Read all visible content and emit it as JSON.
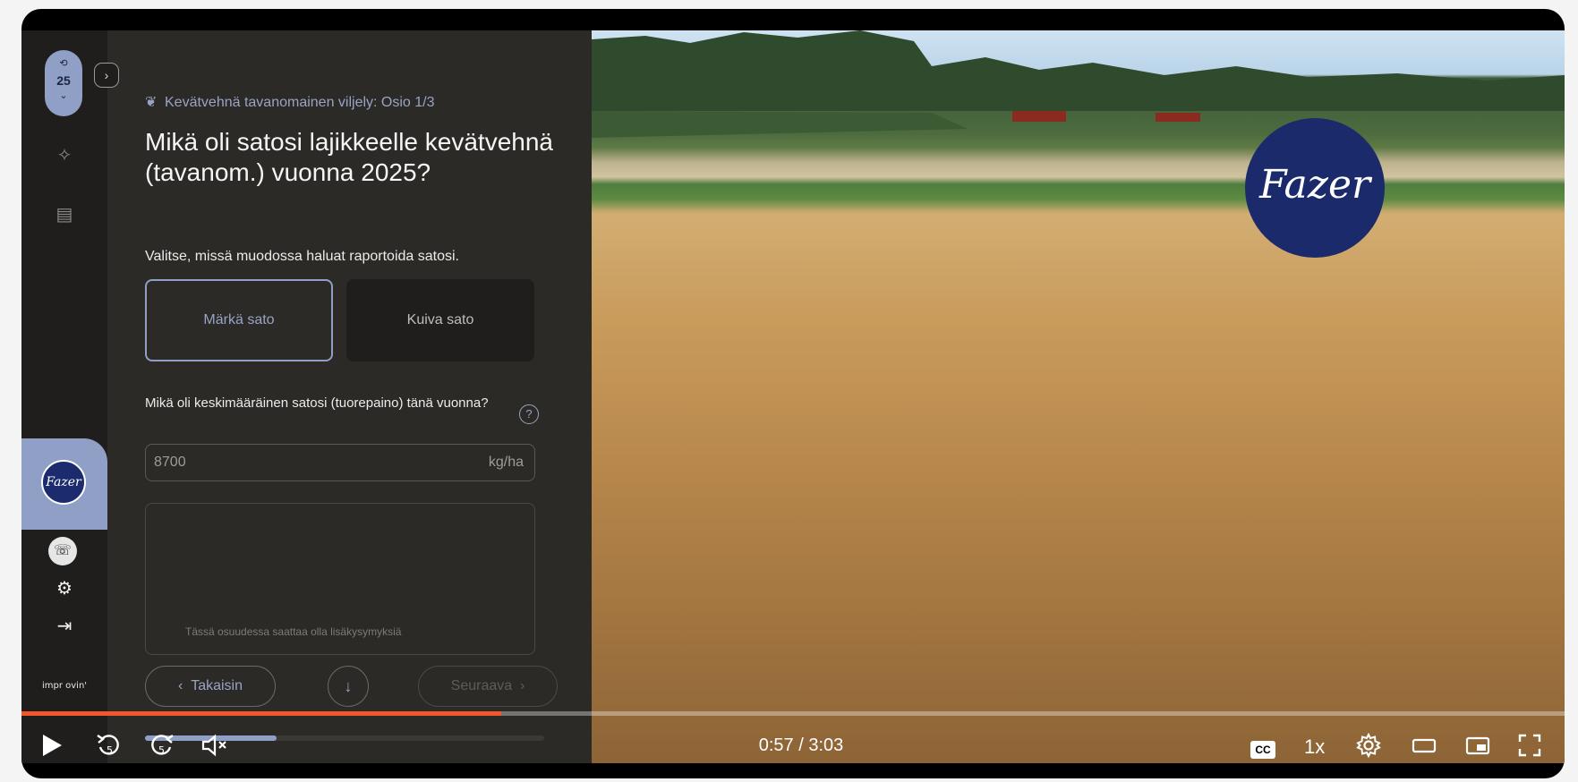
{
  "app": {
    "rail": {
      "counter": "25",
      "brand_logo_text": "Fazer",
      "impr_text": "impr ovin'"
    },
    "breadcrumb": "Kevätvehnä tavanomainen viljely: Osio 1/3",
    "question_title": "Mikä oli satosi lajikkeelle kevätvehnä (tavanom.) vuonna 2025?",
    "subtitle": "Valitse, missä muodossa haluat raportoida satosi.",
    "options": [
      "Märkä sato",
      "Kuiva sato"
    ],
    "yield_question": "Mikä oli keskimääräinen satosi (tuorepaino) tänä vuonna?",
    "yield_value": "8700",
    "yield_unit": "kg/ha",
    "note_text": "Tässä osuudessa saattaa olla lisäkysymyksiä",
    "back_label": "Takaisin",
    "next_label": "Seuraava",
    "section_progress": 0.33
  },
  "video": {
    "overlay_logo_text": "Fazer",
    "time_display": "0:57 / 3:03",
    "playback_progress": 0.311,
    "speed_label": "1x",
    "cc_label": "CC",
    "accent_color": "#f3562c"
  },
  "icons": {
    "play": "play-icon",
    "rewind": "rewind-5-icon",
    "forward": "forward-5-icon",
    "mute": "volume-muted-icon",
    "settings": "gear-icon",
    "theater": "theater-mode-icon",
    "miniplayer": "miniplayer-icon",
    "fullscreen": "fullscreen-icon"
  }
}
